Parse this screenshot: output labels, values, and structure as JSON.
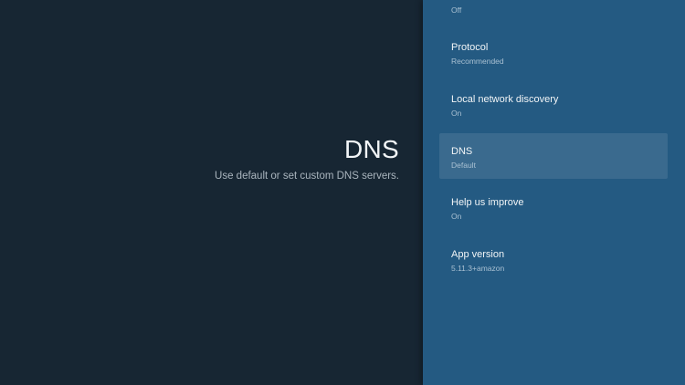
{
  "detail": {
    "title": "DNS",
    "description": "Use default or set custom DNS servers."
  },
  "settings": {
    "items": [
      {
        "label": "",
        "value": "Off"
      },
      {
        "label": "Protocol",
        "value": "Recommended"
      },
      {
        "label": "Local network discovery",
        "value": "On"
      },
      {
        "label": "DNS",
        "value": "Default"
      },
      {
        "label": "Help us improve",
        "value": "On"
      },
      {
        "label": "App version",
        "value": "5.11.3+amazon"
      }
    ]
  },
  "colors": {
    "background": "#172633",
    "panel": "#245a82",
    "selected_highlight": "#35698f",
    "text_primary": "#f2f5f7",
    "text_secondary": "#a9c0d2"
  }
}
